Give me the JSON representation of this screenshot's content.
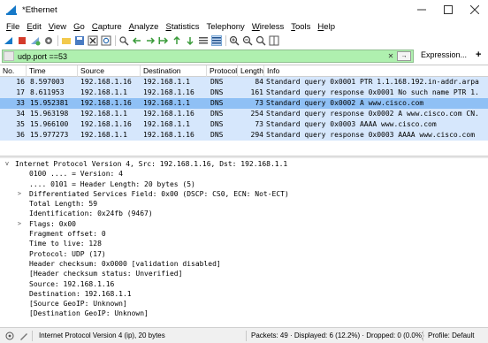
{
  "window": {
    "title": "*Ethernet"
  },
  "menu": [
    {
      "accel": "F",
      "rest": "ile"
    },
    {
      "accel": "E",
      "rest": "dit"
    },
    {
      "accel": "V",
      "rest": "iew"
    },
    {
      "accel": "G",
      "rest": "o"
    },
    {
      "accel": "C",
      "rest": "apture"
    },
    {
      "accel": "A",
      "rest": "nalyze"
    },
    {
      "accel": "S",
      "rest": "tatistics"
    },
    {
      "accel": "",
      "rest": "Telephony"
    },
    {
      "accel": "W",
      "rest": "ireless"
    },
    {
      "accel": "T",
      "rest": "ools"
    },
    {
      "accel": "H",
      "rest": "elp"
    }
  ],
  "filter": {
    "value": "udp.port ==53",
    "expression_label": "Expression...",
    "plus_label": "+"
  },
  "packet_list": {
    "columns": [
      "No.",
      "Time",
      "Source",
      "Destination",
      "Protocol",
      "Length",
      "Info"
    ],
    "rows": [
      {
        "no": "16",
        "time": "8.597003",
        "src": "192.168.1.16",
        "dst": "192.168.1.1",
        "proto": "DNS",
        "len": "84",
        "info": "Standard query 0x0001 PTR 1.1.168.192.in-addr.arpa"
      },
      {
        "no": "17",
        "time": "8.611953",
        "src": "192.168.1.1",
        "dst": "192.168.1.16",
        "proto": "DNS",
        "len": "161",
        "info": "Standard query response 0x0001 No such name PTR 1."
      },
      {
        "no": "33",
        "time": "15.952381",
        "src": "192.168.1.16",
        "dst": "192.168.1.1",
        "proto": "DNS",
        "len": "73",
        "info": "Standard query 0x0002 A www.cisco.com"
      },
      {
        "no": "34",
        "time": "15.963198",
        "src": "192.168.1.1",
        "dst": "192.168.1.16",
        "proto": "DNS",
        "len": "254",
        "info": "Standard query response 0x0002 A www.cisco.com CN."
      },
      {
        "no": "35",
        "time": "15.966100",
        "src": "192.168.1.16",
        "dst": "192.168.1.1",
        "proto": "DNS",
        "len": "73",
        "info": "Standard query 0x0003 AAAA www.cisco.com"
      },
      {
        "no": "36",
        "time": "15.977273",
        "src": "192.168.1.1",
        "dst": "192.168.1.16",
        "proto": "DNS",
        "len": "294",
        "info": "Standard query response 0x0003 AAAA www.cisco.com"
      }
    ],
    "selected_index": 2
  },
  "details": [
    {
      "text": "Internet Protocol Version 4, Src: 192.168.1.16, Dst: 192.168.1.1",
      "twisty": "v",
      "level": 0
    },
    {
      "text": "0100 .... = Version: 4",
      "twisty": "",
      "level": 1
    },
    {
      "text": ".... 0101 = Header Length: 20 bytes (5)",
      "twisty": "",
      "level": 1
    },
    {
      "text": "Differentiated Services Field: 0x00 (DSCP: CS0, ECN: Not-ECT)",
      "twisty": ">",
      "level": 1
    },
    {
      "text": "Total Length: 59",
      "twisty": "",
      "level": 1
    },
    {
      "text": "Identification: 0x24fb (9467)",
      "twisty": "",
      "level": 1
    },
    {
      "text": "Flags: 0x00",
      "twisty": ">",
      "level": 1
    },
    {
      "text": "Fragment offset: 0",
      "twisty": "",
      "level": 1
    },
    {
      "text": "Time to live: 128",
      "twisty": "",
      "level": 1
    },
    {
      "text": "Protocol: UDP (17)",
      "twisty": "",
      "level": 1
    },
    {
      "text": "Header checksum: 0x0000 [validation disabled]",
      "twisty": "",
      "level": 1
    },
    {
      "text": "[Header checksum status: Unverified]",
      "twisty": "",
      "level": 1
    },
    {
      "text": "Source: 192.168.1.16",
      "twisty": "",
      "level": 1
    },
    {
      "text": "Destination: 192.168.1.1",
      "twisty": "",
      "level": 1
    },
    {
      "text": "[Source GeoIP: Unknown]",
      "twisty": "",
      "level": 1
    },
    {
      "text": "[Destination GeoIP: Unknown]",
      "twisty": "",
      "level": 1
    }
  ],
  "status": {
    "field_text": "Internet Protocol Version 4 (ip), 20 bytes",
    "counts": "Packets: 49 · Displayed: 6 (12.2%) · Dropped: 0 (0.0%)",
    "profile": "Profile: Default"
  },
  "colors": {
    "filter_valid": "#aff0af",
    "row_dns": "#d6e7fc",
    "row_selected": "#8fc0f5"
  },
  "toolbar_icons": [
    "shark-fin-start-icon",
    "stop-icon",
    "restart-icon",
    "options-gear-icon",
    "open-folder-icon",
    "save-file-icon",
    "close-file-icon",
    "reload-icon",
    "find-packet-icon",
    "go-back-icon",
    "go-forward-icon",
    "go-to-packet-icon",
    "go-first-icon",
    "go-last-icon",
    "auto-scroll-icon",
    "colorize-icon",
    "zoom-in-icon",
    "zoom-out-icon",
    "zoom-normal-icon",
    "resize-columns-icon"
  ]
}
